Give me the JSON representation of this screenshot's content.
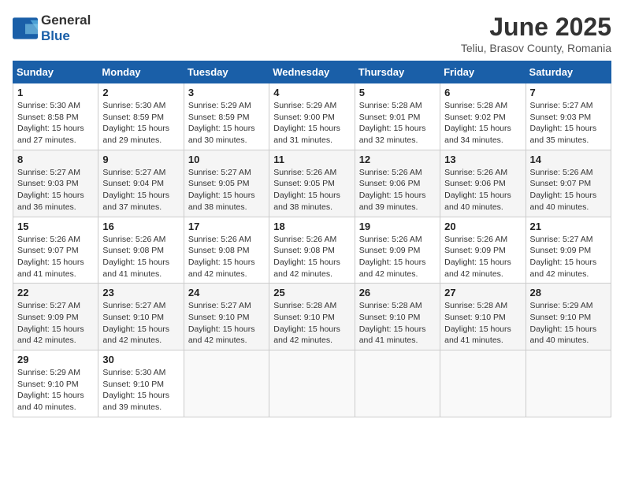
{
  "header": {
    "logo_general": "General",
    "logo_blue": "Blue",
    "title": "June 2025",
    "subtitle": "Teliu, Brasov County, Romania"
  },
  "weekdays": [
    "Sunday",
    "Monday",
    "Tuesday",
    "Wednesday",
    "Thursday",
    "Friday",
    "Saturday"
  ],
  "weeks": [
    [
      {
        "day": "1",
        "sunrise": "5:30 AM",
        "sunset": "8:58 PM",
        "daylight": "15 hours and 27 minutes."
      },
      {
        "day": "2",
        "sunrise": "5:30 AM",
        "sunset": "8:59 PM",
        "daylight": "15 hours and 29 minutes."
      },
      {
        "day": "3",
        "sunrise": "5:29 AM",
        "sunset": "8:59 PM",
        "daylight": "15 hours and 30 minutes."
      },
      {
        "day": "4",
        "sunrise": "5:29 AM",
        "sunset": "9:00 PM",
        "daylight": "15 hours and 31 minutes."
      },
      {
        "day": "5",
        "sunrise": "5:28 AM",
        "sunset": "9:01 PM",
        "daylight": "15 hours and 32 minutes."
      },
      {
        "day": "6",
        "sunrise": "5:28 AM",
        "sunset": "9:02 PM",
        "daylight": "15 hours and 34 minutes."
      },
      {
        "day": "7",
        "sunrise": "5:27 AM",
        "sunset": "9:03 PM",
        "daylight": "15 hours and 35 minutes."
      }
    ],
    [
      {
        "day": "8",
        "sunrise": "5:27 AM",
        "sunset": "9:03 PM",
        "daylight": "15 hours and 36 minutes."
      },
      {
        "day": "9",
        "sunrise": "5:27 AM",
        "sunset": "9:04 PM",
        "daylight": "15 hours and 37 minutes."
      },
      {
        "day": "10",
        "sunrise": "5:27 AM",
        "sunset": "9:05 PM",
        "daylight": "15 hours and 38 minutes."
      },
      {
        "day": "11",
        "sunrise": "5:26 AM",
        "sunset": "9:05 PM",
        "daylight": "15 hours and 38 minutes."
      },
      {
        "day": "12",
        "sunrise": "5:26 AM",
        "sunset": "9:06 PM",
        "daylight": "15 hours and 39 minutes."
      },
      {
        "day": "13",
        "sunrise": "5:26 AM",
        "sunset": "9:06 PM",
        "daylight": "15 hours and 40 minutes."
      },
      {
        "day": "14",
        "sunrise": "5:26 AM",
        "sunset": "9:07 PM",
        "daylight": "15 hours and 40 minutes."
      }
    ],
    [
      {
        "day": "15",
        "sunrise": "5:26 AM",
        "sunset": "9:07 PM",
        "daylight": "15 hours and 41 minutes."
      },
      {
        "day": "16",
        "sunrise": "5:26 AM",
        "sunset": "9:08 PM",
        "daylight": "15 hours and 41 minutes."
      },
      {
        "day": "17",
        "sunrise": "5:26 AM",
        "sunset": "9:08 PM",
        "daylight": "15 hours and 42 minutes."
      },
      {
        "day": "18",
        "sunrise": "5:26 AM",
        "sunset": "9:08 PM",
        "daylight": "15 hours and 42 minutes."
      },
      {
        "day": "19",
        "sunrise": "5:26 AM",
        "sunset": "9:09 PM",
        "daylight": "15 hours and 42 minutes."
      },
      {
        "day": "20",
        "sunrise": "5:26 AM",
        "sunset": "9:09 PM",
        "daylight": "15 hours and 42 minutes."
      },
      {
        "day": "21",
        "sunrise": "5:27 AM",
        "sunset": "9:09 PM",
        "daylight": "15 hours and 42 minutes."
      }
    ],
    [
      {
        "day": "22",
        "sunrise": "5:27 AM",
        "sunset": "9:09 PM",
        "daylight": "15 hours and 42 minutes."
      },
      {
        "day": "23",
        "sunrise": "5:27 AM",
        "sunset": "9:10 PM",
        "daylight": "15 hours and 42 minutes."
      },
      {
        "day": "24",
        "sunrise": "5:27 AM",
        "sunset": "9:10 PM",
        "daylight": "15 hours and 42 minutes."
      },
      {
        "day": "25",
        "sunrise": "5:28 AM",
        "sunset": "9:10 PM",
        "daylight": "15 hours and 42 minutes."
      },
      {
        "day": "26",
        "sunrise": "5:28 AM",
        "sunset": "9:10 PM",
        "daylight": "15 hours and 41 minutes."
      },
      {
        "day": "27",
        "sunrise": "5:28 AM",
        "sunset": "9:10 PM",
        "daylight": "15 hours and 41 minutes."
      },
      {
        "day": "28",
        "sunrise": "5:29 AM",
        "sunset": "9:10 PM",
        "daylight": "15 hours and 40 minutes."
      }
    ],
    [
      {
        "day": "29",
        "sunrise": "5:29 AM",
        "sunset": "9:10 PM",
        "daylight": "15 hours and 40 minutes."
      },
      {
        "day": "30",
        "sunrise": "5:30 AM",
        "sunset": "9:10 PM",
        "daylight": "15 hours and 39 minutes."
      },
      null,
      null,
      null,
      null,
      null
    ]
  ]
}
